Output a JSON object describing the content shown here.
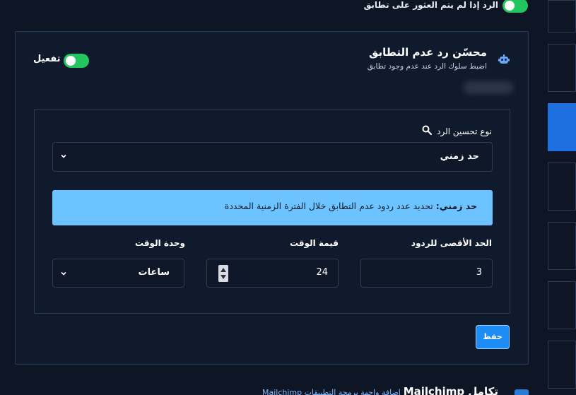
{
  "top_toggle": {
    "label": "الرد إذا لم يتم العثور على تطابق",
    "enabled": true
  },
  "card": {
    "title": "محسّن رد عدم التطابق",
    "subtitle": "اضبط سلوك الرد عند عدم وجود تطابق",
    "activate_label": "تفعيل",
    "activate_enabled": true,
    "icon": "robot-icon"
  },
  "form": {
    "type_label": "نوع تحسين الرد",
    "type_value": "حد زمني",
    "info_bold": "حد زمني:",
    "info_text": " تحديد عدد ردود عدم التطابق خلال الفترة الزمنية المحددة",
    "max_replies_label": "الحد الأقصى للردود",
    "max_replies_value": "3",
    "time_value_label": "قيمة الوقت",
    "time_value_value": "24",
    "time_unit_label": "وحدة الوقت",
    "time_unit_value": "ساعات",
    "save_label": "حفظ"
  },
  "bottom": {
    "integration_label": "تكامل Mailchimp",
    "integration_link": "إضافة واجهة برمجة التطبيقات Mailchimp"
  },
  "colors": {
    "accent": "#1d8df5",
    "toggle_on": "#22c55e",
    "info_bg": "#6cc3ff"
  }
}
